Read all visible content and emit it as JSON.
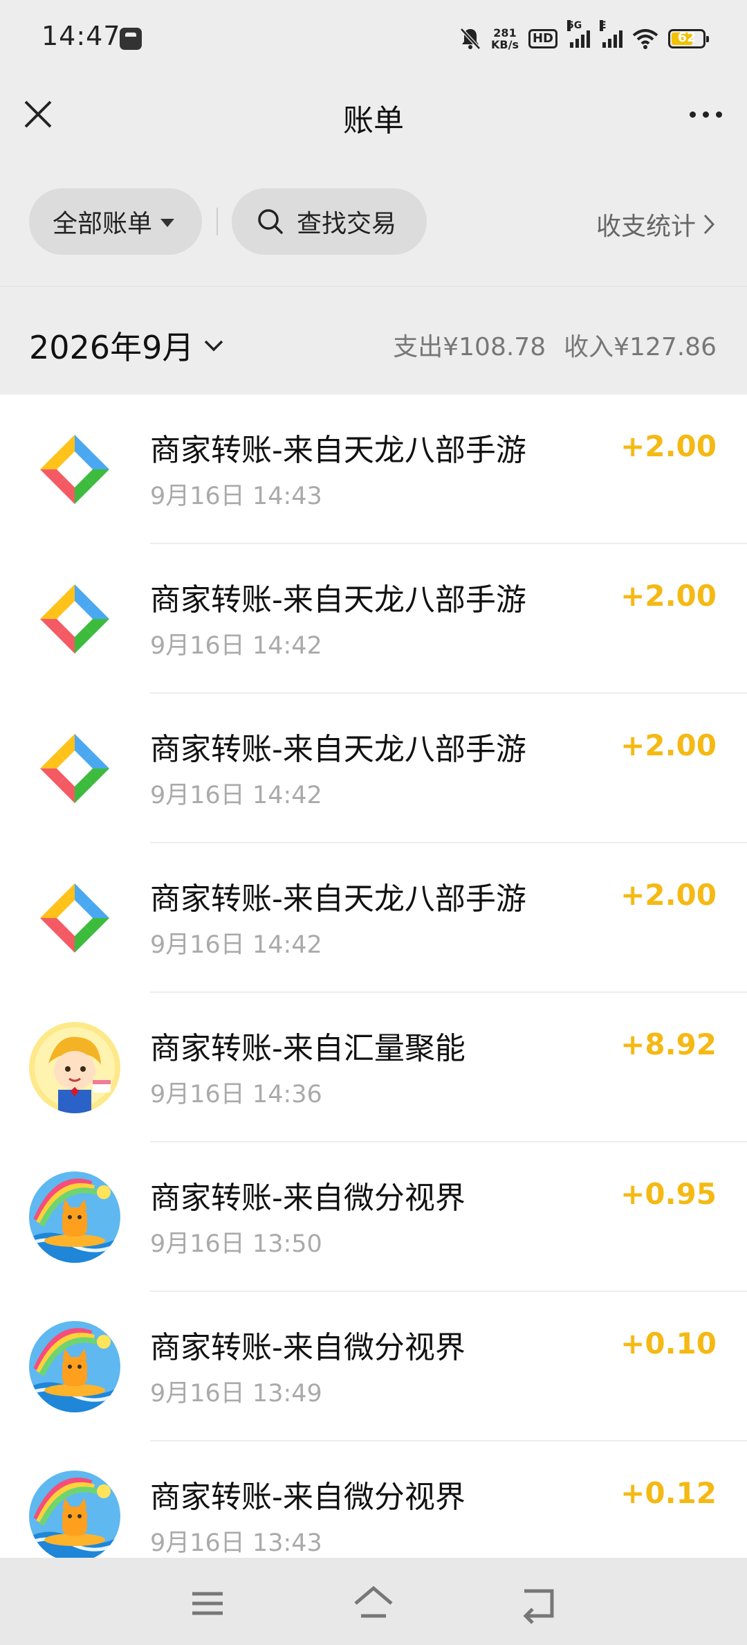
{
  "status_bar": {
    "time": "14:47",
    "net_speed_value": "281",
    "net_speed_unit": "KB/s",
    "hd_label": "HD",
    "network_5g": "5G",
    "network_e": "E",
    "battery": "62"
  },
  "header": {
    "title": "账单"
  },
  "filters": {
    "all_bills_label": "全部账单",
    "search_label": "查找交易",
    "stats_label": "收支统计"
  },
  "month": {
    "label": "2026年9月",
    "expense": "支出¥108.78",
    "income": "收入¥127.86"
  },
  "transactions": [
    {
      "title": "商家转账-来自天龙八部手游",
      "time": "9月16日 14:43",
      "amount": "+2.00",
      "icon": "pinwheel-logo-icon"
    },
    {
      "title": "商家转账-来自天龙八部手游",
      "time": "9月16日 14:42",
      "amount": "+2.00",
      "icon": "pinwheel-logo-icon"
    },
    {
      "title": "商家转账-来自天龙八部手游",
      "time": "9月16日 14:42",
      "amount": "+2.00",
      "icon": "pinwheel-logo-icon"
    },
    {
      "title": "商家转账-来自天龙八部手游",
      "time": "9月16日 14:42",
      "amount": "+2.00",
      "icon": "pinwheel-logo-icon"
    },
    {
      "title": "商家转账-来自汇量聚能",
      "time": "9月16日 14:36",
      "amount": "+8.92",
      "icon": "cartoon-boy-avatar"
    },
    {
      "title": "商家转账-来自微分视界",
      "time": "9月16日 13:50",
      "amount": "+0.95",
      "icon": "surfing-cat-avatar"
    },
    {
      "title": "商家转账-来自微分视界",
      "time": "9月16日 13:49",
      "amount": "+0.10",
      "icon": "surfing-cat-avatar"
    },
    {
      "title": "商家转账-来自微分视界",
      "time": "9月16日 13:43",
      "amount": "+0.12",
      "icon": "surfing-cat-avatar"
    }
  ],
  "colors": {
    "income_amount": "#f5b914",
    "background": "#ededed"
  }
}
